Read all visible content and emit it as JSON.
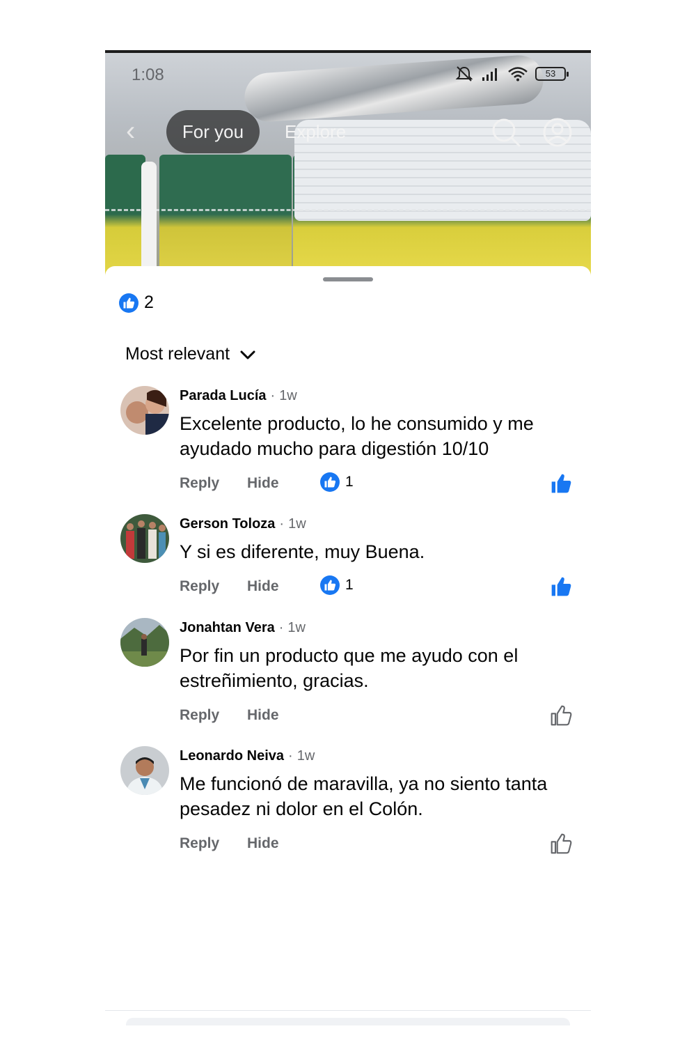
{
  "status_bar": {
    "time": "1:08",
    "battery": "53",
    "icons": [
      "mute-icon",
      "signal-icon",
      "wifi-icon",
      "battery-icon"
    ]
  },
  "top_nav": {
    "tabs": [
      {
        "label": "For you",
        "selected": true
      },
      {
        "label": "Explore",
        "selected": false
      }
    ],
    "icons": [
      "back-chevron-icon",
      "search-icon",
      "profile-icon"
    ]
  },
  "post": {
    "reaction_count": "2",
    "sort_label": "Most relevant"
  },
  "comments": [
    {
      "author": "Parada Lucía",
      "time": "1w",
      "text": "Excelente producto, lo he consumido y me ayudado mucho para digestión 10/10",
      "reply": "Reply",
      "hide": "Hide",
      "likes": "1",
      "liked": true
    },
    {
      "author": "Gerson Toloza",
      "time": "1w",
      "text": "Y si es diferente, muy Buena.",
      "reply": "Reply",
      "hide": "Hide",
      "likes": "1",
      "liked": true
    },
    {
      "author": "Jonahtan Vera",
      "time": "1w",
      "text": "Por fin un producto que me ayudo con el estreñimiento, gracias.",
      "reply": "Reply",
      "hide": "Hide",
      "likes": "",
      "liked": false
    },
    {
      "author": "Leonardo Neiva",
      "time": "1w",
      "text": "Me funcionó de maravilla, ya no siento tanta pesadez ni dolor en el Colón.",
      "reply": "Reply",
      "hide": "Hide",
      "likes": "",
      "liked": false
    }
  ],
  "colors": {
    "facebook_blue": "#1877f2",
    "secondary_text": "#65676b"
  }
}
